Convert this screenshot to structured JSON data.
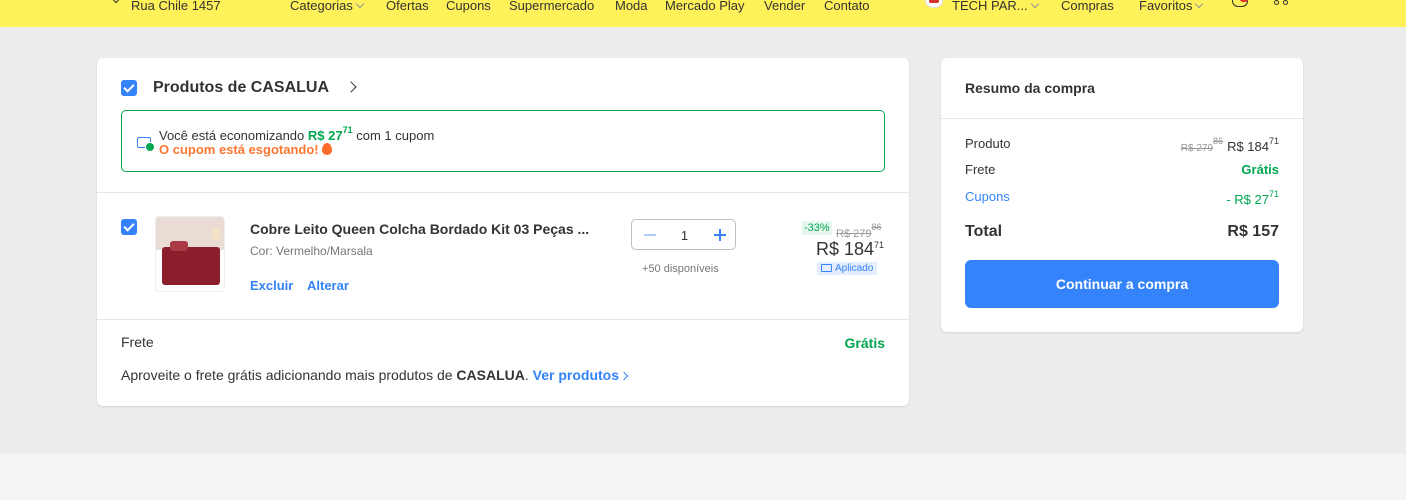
{
  "header": {
    "location": "Rua Chile 1457",
    "nav": [
      "Categorias",
      "Ofertas",
      "Cupons",
      "Supermercado",
      "Moda",
      "Mercado Play",
      "Vender",
      "Contato"
    ],
    "account": "TECH PAR...",
    "purchases": "Compras",
    "favorites": "Favoritos",
    "brand_color": "#fff159"
  },
  "cart": {
    "seller_name": "Produtos de CASALUA",
    "coupon": {
      "text_before": "Você está economizando",
      "amount": "R$ 27",
      "amount_cents": "71",
      "text_after": "com 1 cupom",
      "warning": "O cupom está esgotando!"
    },
    "item": {
      "title": "Cobre Leito Queen Colcha Bordado Kit 03 Peças ...",
      "variant": "Cor: Vermelho/Marsala",
      "delete_label": "Excluir",
      "change_label": "Alterar",
      "quantity": "1",
      "availability": "+50 disponíveis",
      "discount": "-33%",
      "old_price": "R$ 279",
      "old_price_cents": "86",
      "price": "R$ 184",
      "price_cents": "71",
      "applied_label": "Aplicado"
    },
    "shipping": {
      "label": "Frete",
      "value": "Grátis",
      "promo_text": "Aproveite o frete grátis adicionando mais produtos de",
      "promo_seller": "CASALUA",
      "promo_link": "Ver produtos"
    }
  },
  "summary": {
    "title": "Resumo da compra",
    "product_label": "Produto",
    "product_old": "R$ 279",
    "product_old_cents": "86",
    "product_price": "R$ 184",
    "product_price_cents": "71",
    "shipping_label": "Frete",
    "shipping_value": "Grátis",
    "coupons_label": "Cupons",
    "coupons_value": "- R$ 27",
    "coupons_value_cents": "71",
    "total_label": "Total",
    "total_value": "R$ 157",
    "continue_label": "Continuar a compra",
    "accent_color": "#3483fa",
    "success_color": "#00a650"
  }
}
